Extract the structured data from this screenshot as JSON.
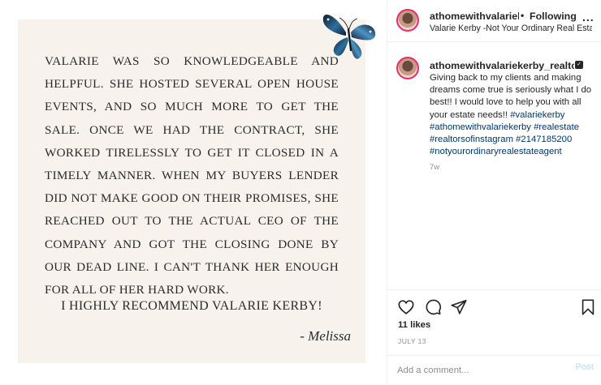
{
  "post": {
    "testimonial": "VALARIE WAS SO KNOWLEDGEABLE AND HELPFUL. SHE HOSTED SEVERAL OPEN HOUSE EVENTS, AND SO MUCH MORE TO GET THE SALE. ONCE WE HAD THE CONTRACT, SHE WORKED TIRELESSLY TO GET IT CLOSED IN A TIMELY MANNER. WHEN MY BUYERS LENDER DID NOT MAKE GOOD ON THEIR PROMISES, SHE REACHED OUT TO THE ACTUAL CEO OF THE COMPANY AND GOT THE CLOSING DONE BY OUR DEAD LINE. I CAN'T THANK HER ENOUGH FOR ALL OF HER HARD WORK.",
    "recommendation": "I HIGHLY RECOMMEND VALARIE KERBY!",
    "signature": "- Melissa"
  },
  "header": {
    "username": "athomewithvalariekerby_realtor",
    "separator": "•",
    "follow_label": "Following",
    "more_icon": "more-horizontal-icon",
    "more_glyph": "...",
    "subtitle": "Valarie Kerby -Not Your Ordinary Real Estate Agent"
  },
  "caption": {
    "username": "athomewithvalariekerby_realtor",
    "verified_glyph": "✓",
    "text": "Giving back to my clients and making dreams come true is seriously what I do best!! I would love to help you with all your estate needs!!",
    "hashtags": [
      "#valariekerby",
      "#athomewithvalariekerby",
      "#realestate",
      "#realtorsofinstagram",
      "#2147185200",
      "#notyourordinaryrealestateagent"
    ],
    "age": "7w"
  },
  "actions": {
    "icons": [
      "heart-icon",
      "comment-icon",
      "share-icon",
      "bookmark-icon"
    ],
    "likes": "11 likes",
    "date": "JULY 13"
  },
  "comment": {
    "placeholder": "Add a comment...",
    "post_label": "Post"
  },
  "colors": {
    "card_bg": "#f7f2ec",
    "link": "#00376b",
    "post_button": "#b2dffc",
    "muted": "#8e8e8e"
  }
}
